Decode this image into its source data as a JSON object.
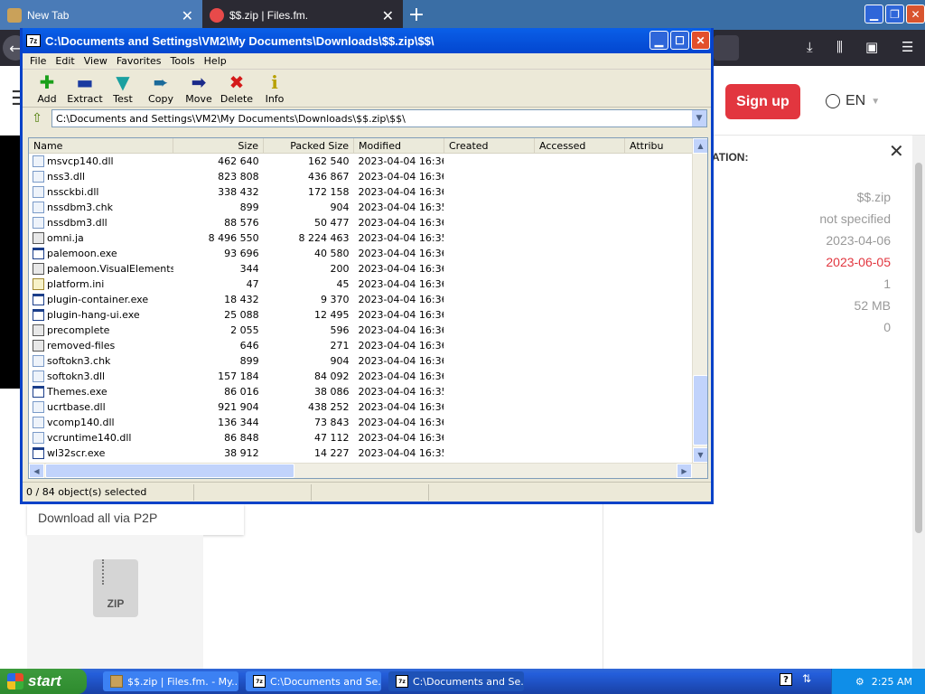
{
  "browser": {
    "tabs": [
      {
        "label": "New Tab"
      },
      {
        "label": "$$.zip | Files.fm."
      }
    ],
    "close_glyph": "✕",
    "new_tab_glyph": "+"
  },
  "page": {
    "signup_label": "Sign up",
    "language": "EN",
    "info_title": "ATION:",
    "info_values": [
      "$$.zip",
      "not specified",
      "2023-04-06",
      "2023-06-05",
      "1",
      "52 MB",
      "0"
    ],
    "download_p2p": "Download all via P2P",
    "zip_badge": "ZIP",
    "accent_red": "#e2363f"
  },
  "zip_window": {
    "title": "C:\\Documents and Settings\\VM2\\My Documents\\Downloads\\$$.zip\\$$\\",
    "app_icon": "7z",
    "menu": [
      "File",
      "Edit",
      "View",
      "Favorites",
      "Tools",
      "Help"
    ],
    "toolbar": [
      {
        "label": "Add",
        "glyph": "✚",
        "icon": "add-icon",
        "cls": "add"
      },
      {
        "label": "Extract",
        "glyph": "▬",
        "icon": "extract-icon",
        "cls": "extract"
      },
      {
        "label": "Test",
        "glyph": "▼",
        "icon": "test-icon",
        "cls": "test"
      },
      {
        "label": "Copy",
        "glyph": "➨",
        "icon": "copy-icon",
        "cls": "copy"
      },
      {
        "label": "Move",
        "glyph": "➡",
        "icon": "move-icon",
        "cls": "move"
      },
      {
        "label": "Delete",
        "glyph": "✖",
        "icon": "delete-icon",
        "cls": "delete"
      },
      {
        "label": "Info",
        "glyph": "i",
        "icon": "info-icon",
        "cls": "info"
      }
    ],
    "address": "C:\\Documents and Settings\\VM2\\My Documents\\Downloads\\$$.zip\\$$\\",
    "columns": {
      "name": "Name",
      "size": "Size",
      "packed": "Packed Size",
      "modified": "Modified",
      "created": "Created",
      "accessed": "Accessed",
      "attributes": "Attribu"
    },
    "files": [
      {
        "name": "msvcp140.dll",
        "size": "462 640",
        "packed": "162 540",
        "modified": "2023-04-04 16:36",
        "type": "dll"
      },
      {
        "name": "nss3.dll",
        "size": "823 808",
        "packed": "436 867",
        "modified": "2023-04-04 16:36",
        "type": "dll"
      },
      {
        "name": "nssckbi.dll",
        "size": "338 432",
        "packed": "172 158",
        "modified": "2023-04-04 16:36",
        "type": "dll"
      },
      {
        "name": "nssdbm3.chk",
        "size": "899",
        "packed": "904",
        "modified": "2023-04-04 16:35",
        "type": "dll"
      },
      {
        "name": "nssdbm3.dll",
        "size": "88 576",
        "packed": "50 477",
        "modified": "2023-04-04 16:36",
        "type": "dll"
      },
      {
        "name": "omni.ja",
        "size": "8 496 550",
        "packed": "8 224 463",
        "modified": "2023-04-04 16:35",
        "type": "ja"
      },
      {
        "name": "palemoon.exe",
        "size": "93 696",
        "packed": "40 580",
        "modified": "2023-04-04 16:36",
        "type": "exe"
      },
      {
        "name": "palemoon.VisualElements...",
        "size": "344",
        "packed": "200",
        "modified": "2023-04-04 16:36",
        "type": "ja"
      },
      {
        "name": "platform.ini",
        "size": "47",
        "packed": "45",
        "modified": "2023-04-04 16:36",
        "type": "ini"
      },
      {
        "name": "plugin-container.exe",
        "size": "18 432",
        "packed": "9 370",
        "modified": "2023-04-04 16:36",
        "type": "exe"
      },
      {
        "name": "plugin-hang-ui.exe",
        "size": "25 088",
        "packed": "12 495",
        "modified": "2023-04-04 16:36",
        "type": "exe"
      },
      {
        "name": "precomplete",
        "size": "2 055",
        "packed": "596",
        "modified": "2023-04-04 16:36",
        "type": "ja"
      },
      {
        "name": "removed-files",
        "size": "646",
        "packed": "271",
        "modified": "2023-04-04 16:36",
        "type": "ja"
      },
      {
        "name": "softokn3.chk",
        "size": "899",
        "packed": "904",
        "modified": "2023-04-04 16:36",
        "type": "dll"
      },
      {
        "name": "softokn3.dll",
        "size": "157 184",
        "packed": "84 092",
        "modified": "2023-04-04 16:36",
        "type": "dll"
      },
      {
        "name": "Themes.exe",
        "size": "86 016",
        "packed": "38 086",
        "modified": "2023-04-04 16:35",
        "type": "exe"
      },
      {
        "name": "ucrtbase.dll",
        "size": "921 904",
        "packed": "438 252",
        "modified": "2023-04-04 16:36",
        "type": "dll"
      },
      {
        "name": "vcomp140.dll",
        "size": "136 344",
        "packed": "73 843",
        "modified": "2023-04-04 16:36",
        "type": "dll"
      },
      {
        "name": "vcruntime140.dll",
        "size": "86 848",
        "packed": "47 112",
        "modified": "2023-04-04 16:36",
        "type": "dll"
      },
      {
        "name": "wl32scr.exe",
        "size": "38 912",
        "packed": "14 227",
        "modified": "2023-04-04 16:35",
        "type": "exe"
      }
    ],
    "status": "0 / 84 object(s) selected"
  },
  "taskbar": {
    "start_label": "start",
    "buttons": [
      {
        "label": "$$.zip | Files.fm. - My...",
        "icon": "firefox-icon"
      },
      {
        "label": "C:\\Documents and Se...",
        "icon": "7zip-icon"
      },
      {
        "label": "C:\\Documents and Se...",
        "icon": "7zip-icon"
      }
    ],
    "clock": "2:25 AM"
  }
}
